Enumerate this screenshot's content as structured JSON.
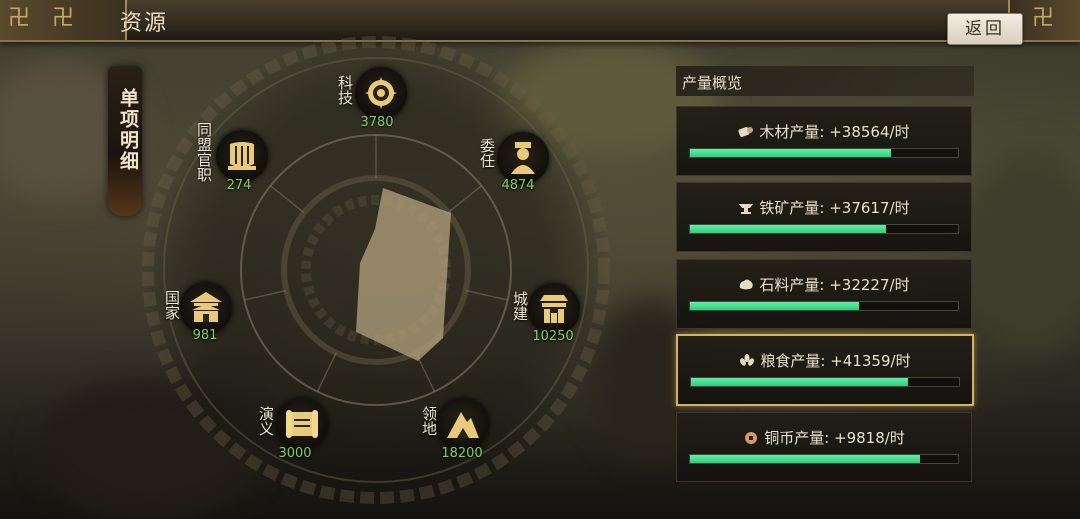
{
  "header": {
    "title": "资源",
    "back_label": "返回"
  },
  "side_tab": {
    "label": "单项明细"
  },
  "wheel": {
    "nodes": [
      {
        "id": "keji",
        "name": "科技",
        "value": "3780",
        "icon": "gear-target-icon"
      },
      {
        "id": "weiren",
        "name": "委任",
        "value": "4874",
        "icon": "official-icon"
      },
      {
        "id": "chengjian",
        "name": "城建",
        "value": "10250",
        "icon": "city-building-icon"
      },
      {
        "id": "lingdi",
        "name": "领地",
        "value": "18200",
        "icon": "mountain-icon"
      },
      {
        "id": "yanyi",
        "name": "演义",
        "value": "3000",
        "icon": "scroll-icon"
      },
      {
        "id": "guojia",
        "name": "国家",
        "value": "981",
        "icon": "palace-icon"
      },
      {
        "id": "tongmeng",
        "name": "同盟官职",
        "value": "274",
        "icon": "alliance-icon"
      }
    ],
    "radar_color": "#b4a37d"
  },
  "panel": {
    "title": "产量概览",
    "rows": [
      {
        "id": "wood",
        "label": "木材产量: +38564/时",
        "icon": "wood-icon",
        "progress": 0.75
      },
      {
        "id": "iron",
        "label": "铁矿产量: +37617/时",
        "icon": "anvil-icon",
        "progress": 0.73
      },
      {
        "id": "stone",
        "label": "石料产量: +32227/时",
        "icon": "stone-icon",
        "progress": 0.63
      },
      {
        "id": "food",
        "label": "粮食产量: +41359/时",
        "icon": "grain-icon",
        "progress": 0.81,
        "selected": true
      },
      {
        "id": "copper",
        "label": "铜币产量: +9818/时",
        "icon": "coin-icon",
        "progress": 0.86
      }
    ],
    "bar_color": "#2fcf7c",
    "highlight_color": "#d6b25c"
  }
}
